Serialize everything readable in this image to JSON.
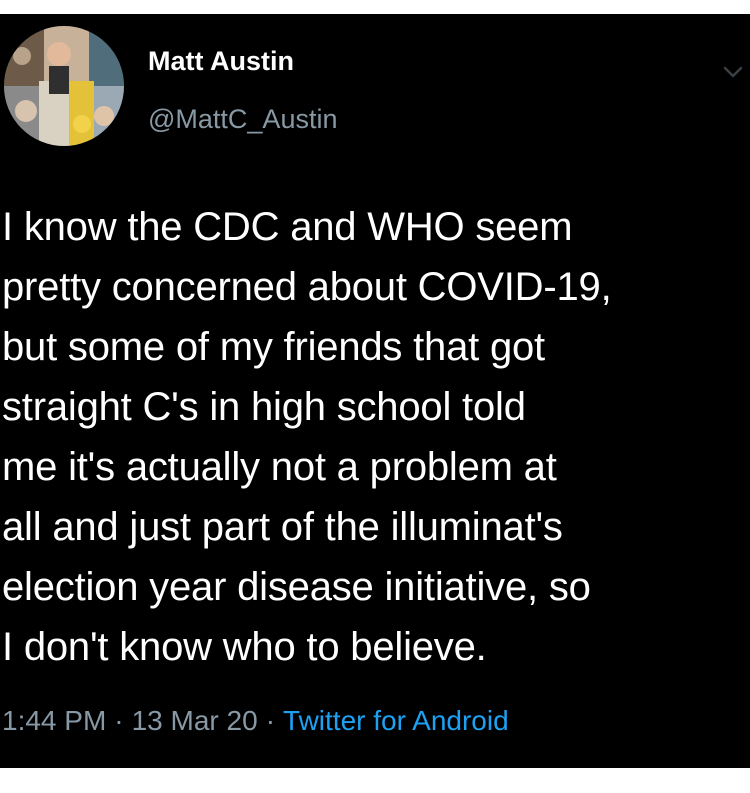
{
  "author": {
    "display_name": "Matt Austin",
    "handle": "@MattC_Austin",
    "avatar_icon": "profile-avatar"
  },
  "tweet": {
    "text": "I know the CDC and WHO seem\npretty concerned about COVID-19,\nbut some of my friends that got\nstraight C's in high school told\nme it's actually not a problem at\nall and just part of the illuminat's\nelection year disease initiative, so\nI don't know who to believe.",
    "time": "1:44 PM",
    "date": "13 Mar 20",
    "separator": "·",
    "source": "Twitter for Android"
  },
  "icons": {
    "more": "chevron-down-icon"
  },
  "colors": {
    "background": "#000000",
    "text": "#ffffff",
    "secondary": "#8899a6",
    "link": "#1da1f2"
  }
}
